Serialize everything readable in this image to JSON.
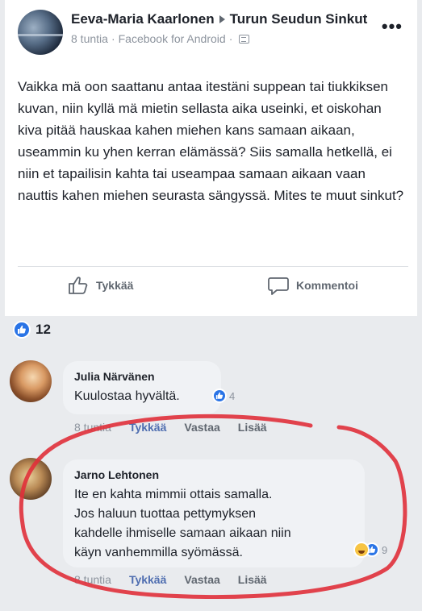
{
  "post": {
    "author": "Eeva-Maria Kaarlonen",
    "group": "Turun Seudun Sinkut",
    "time": "8 tuntia",
    "source": "Facebook for Android",
    "more": "•••",
    "text": "Vaikka mä oon saattanu antaa itestäni suppean tai tiukkiksen kuvan, niin kyllä mä mietin sellasta aika useinki, et oiskohan kiva pitää hauskaa kahen miehen kans samaan aikaan, useammin ku yhen kerran elämässä? Siis samalla hetkellä, ei niin et tapailisin kahta tai useampaa samaan aikaan vaan nauttis kahen miehen seurasta sängyssä. Mites te muut sinkut?",
    "like_label": "Tykkää",
    "comment_label": "Kommentoi",
    "reaction_count": "12"
  },
  "comments": [
    {
      "name": "Julia Närvänen",
      "text": "Kuulostaa hyvältä.",
      "reaction_count": "4",
      "time": "8 tuntia",
      "like": "Tykkää",
      "reply": "Vastaa",
      "more": "Lisää"
    },
    {
      "name": "Jarno Lehtonen",
      "text_lines": [
        "Ite en kahta mimmii ottais samalla.",
        "Jos haluun tuottaa pettymyksen",
        "kahdelle ihmiselle samaan aikaan niin",
        "käyn vanhemmilla syömässä."
      ],
      "reaction_count": "9",
      "time": "8 tuntia",
      "like": "Tykkää",
      "reply": "Vastaa",
      "more": "Lisää"
    }
  ],
  "colors": {
    "like_blue": "#2a74e6",
    "annotation_red": "#e0303a",
    "page_bg": "#e9ebee"
  }
}
